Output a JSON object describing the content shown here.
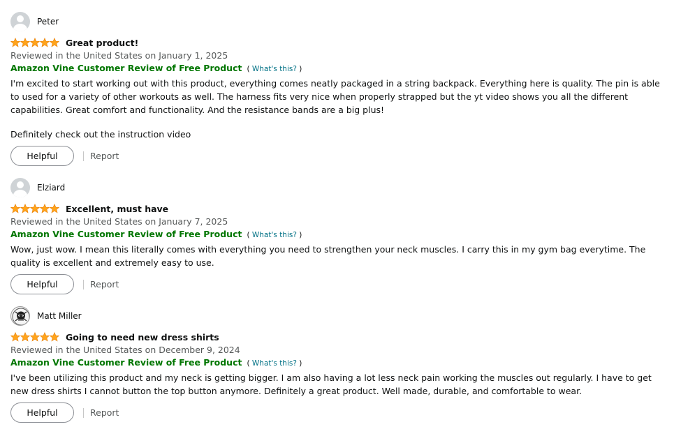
{
  "colors": {
    "star": "#ffa41c",
    "vine_green": "#007600",
    "link": "#007185",
    "muted_text": "#565959"
  },
  "reviews": [
    {
      "author": "Peter",
      "avatar": "default-avatar-icon",
      "rating": 5,
      "title": "Great product!",
      "date": "Reviewed in the United States on January 1, 2025",
      "vine_label": "Amazon Vine Customer Review of Free Product",
      "whats_this_open": "(",
      "whats_this": "What's this?",
      "whats_this_close": ")",
      "body": [
        "I'm excited to start working out with this product, everything comes neatly packaged in a string backpack. Everything here is quality. The pin is able to used for a variety of other workouts as well. The harness fits very nice when properly strapped but the yt video shows you all the different capabilities. Great comfort and functionality. And the resistance bands are a big plus!",
        "Definitely check out the instruction video"
      ],
      "helpful_label": "Helpful",
      "report_label": "Report"
    },
    {
      "author": "Elziard",
      "avatar": "default-avatar-icon",
      "rating": 5,
      "title": "Excellent, must have",
      "date": "Reviewed in the United States on January 7, 2025",
      "vine_label": "Amazon Vine Customer Review of Free Product",
      "whats_this_open": "(",
      "whats_this": "What's this?",
      "whats_this_close": ")",
      "body": [
        "Wow, just wow. I mean this literally comes with everything you need to strengthen your neck muscles. I carry this in my gym bag everytime. The quality is excellent and extremely easy to use."
      ],
      "helpful_label": "Helpful",
      "report_label": "Report"
    },
    {
      "author": "Matt Miller",
      "avatar": "skull-avatar-icon",
      "rating": 5,
      "title": "Going to need new dress shirts",
      "date": "Reviewed in the United States on December 9, 2024",
      "vine_label": "Amazon Vine Customer Review of Free Product",
      "whats_this_open": "(",
      "whats_this": "What's this?",
      "whats_this_close": ")",
      "body": [
        "I've been utilizing this product and my neck is getting bigger. I am also having a lot less neck pain working the muscles out regularly. I have to get new dress shirts I cannot button the top button anymore. Definitely a great product. Well made, durable, and comfortable to wear."
      ],
      "helpful_label": "Helpful",
      "report_label": "Report"
    }
  ]
}
